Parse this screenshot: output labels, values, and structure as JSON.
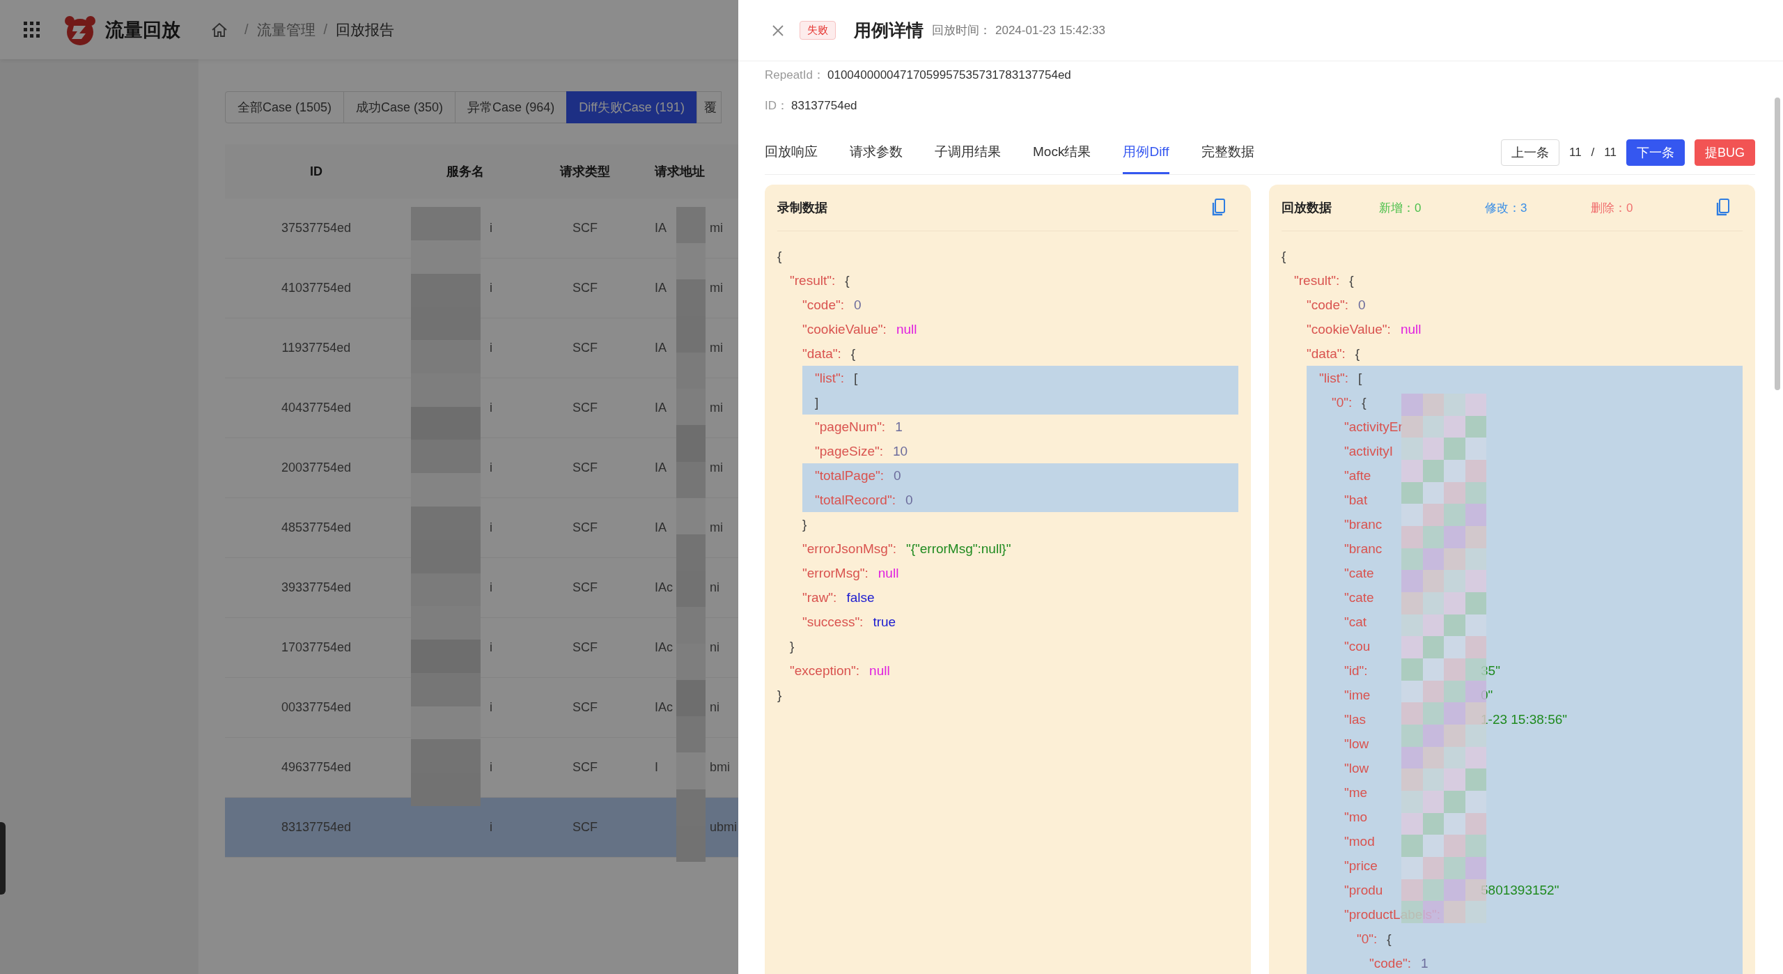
{
  "app": {
    "title": "流量回放",
    "breadcrumb": [
      {
        "separator": "/",
        "label": "流量管理"
      },
      {
        "separator": "/",
        "label": "回放报告"
      }
    ],
    "case_tabs": [
      {
        "label": "全部Case (1505)",
        "selected": false
      },
      {
        "label": "成功Case (350)",
        "selected": false
      },
      {
        "label": "异常Case (964)",
        "selected": false
      },
      {
        "label": "Diff失败Case (191)",
        "selected": true
      },
      {
        "label": "覆",
        "selected": false
      }
    ],
    "table": {
      "columns": [
        "ID",
        "服务名",
        "请求类型",
        "请求地址"
      ],
      "rows": [
        {
          "id": "37537754ed",
          "service": "i",
          "type": "SCF",
          "address": "IA",
          "column_5": "mi",
          "selected": false
        },
        {
          "id": "41037754ed",
          "service": "i",
          "type": "SCF",
          "address": "IA",
          "column_5": "mi",
          "selected": false
        },
        {
          "id": "11937754ed",
          "service": "i",
          "type": "SCF",
          "address": "IA",
          "column_5": "mi",
          "selected": false
        },
        {
          "id": "40437754ed",
          "service": "i",
          "type": "SCF",
          "address": "IA",
          "column_5": "mi",
          "selected": false
        },
        {
          "id": "20037754ed",
          "service": "i",
          "type": "SCF",
          "address": "IA",
          "column_5": "mi",
          "selected": false
        },
        {
          "id": "48537754ed",
          "service": "i",
          "type": "SCF",
          "address": "IA",
          "column_5": "mi",
          "selected": false
        },
        {
          "id": "39337754ed",
          "service": "i",
          "type": "SCF",
          "address": "IAc",
          "column_5": "ni",
          "selected": false
        },
        {
          "id": "17037754ed",
          "service": "i",
          "type": "SCF",
          "address": "IAc",
          "column_5": "ni",
          "selected": false
        },
        {
          "id": "00337754ed",
          "service": "i",
          "type": "SCF",
          "address": "IAc",
          "column_5": "ni",
          "selected": false
        },
        {
          "id": "49637754ed",
          "service": "i",
          "type": "SCF",
          "address": "I",
          "column_5": "bmi",
          "selected": false
        },
        {
          "id": "83137754ed",
          "service": "i",
          "type": "SCF",
          "column_5": "ubmi",
          "selected": true
        }
      ]
    }
  },
  "drawer": {
    "status": "失败",
    "title": "用例详情",
    "time_label": "回放时间：",
    "time": "2024-01-23 15:42:33",
    "repeat_id_label": "RepeatId：",
    "repeat_id": "01004000004717059957535731783137754ed",
    "id_label": "ID：",
    "id": "83137754ed",
    "tabs": [
      {
        "label": "回放响应",
        "selected": false
      },
      {
        "label": "请求参数",
        "selected": false
      },
      {
        "label": "子调用结果",
        "selected": false
      },
      {
        "label": "Mock结果",
        "selected": false
      },
      {
        "label": "用例Diff",
        "selected": true
      },
      {
        "label": "完整数据",
        "selected": false
      }
    ],
    "pager": {
      "prev": "上一条",
      "current": "11",
      "separator": "/",
      "total": "11",
      "next": "下一条"
    },
    "bug_button": "提BUG",
    "panels": [
      {
        "title": "录制数据",
        "code": {
          "kind": "branch",
          "open": "{",
          "close": "}",
          "children": [
            {
              "kind": "branch",
              "key": "\"result\":",
              "open": "{",
              "close": "}",
              "children": [
                {
                  "kind": "pair",
                  "key": "\"code\":",
                  "value": "0",
                  "color": "#6c6c9c"
                },
                {
                  "kind": "pair",
                  "key": "\"cookieValue\":",
                  "value": "null",
                  "color": "#e020e0"
                },
                {
                  "kind": "branch",
                  "key": "\"data\":",
                  "open": "{",
                  "close": "}",
                  "children": [
                    {
                      "kind": "branch",
                      "key": "\"list\":",
                      "open": "[",
                      "close": "]",
                      "highlighted": true
                    },
                    {
                      "kind": "pair",
                      "key": "\"pageNum\":",
                      "value": "1",
                      "color": "#6c6c9c",
                      "highlighted": false
                    },
                    {
                      "kind": "pair",
                      "key": "\"pageSize\":",
                      "value": "10",
                      "color": "#6c6c9c",
                      "highlighted": false
                    },
                    {
                      "kind": "pair",
                      "key": "\"totalPage\":",
                      "value": "0",
                      "color": "#6c6c9c",
                      "highlighted": true
                    },
                    {
                      "kind": "pair",
                      "key": "\"totalRecord\":",
                      "value": "0",
                      "color": "#6c6c9c",
                      "highlighted": true
                    }
                  ]
                },
                {
                  "kind": "pair",
                  "key": "\"errorJsonMsg\":",
                  "value": "\"{\"errorMsg\":null}\"",
                  "color": "#1f8a1f"
                },
                {
                  "kind": "pair",
                  "key": "\"errorMsg\":",
                  "value": "null",
                  "color": "#e020e0"
                },
                {
                  "kind": "pair",
                  "key": "\"raw\":",
                  "value": "false",
                  "color": "#1a1ad0"
                },
                {
                  "kind": "pair",
                  "key": "\"success\":",
                  "value": "true",
                  "color": "#1a1ad0"
                }
              ]
            },
            {
              "kind": "pair",
              "key": "\"exception\":",
              "value": "null",
              "color": "#e020e0"
            }
          ]
        }
      },
      {
        "title": "回放数据",
        "stats": [
          {
            "label": "新增：",
            "value": "0",
            "kind": "added"
          },
          {
            "label": "修改：",
            "value": "3",
            "kind": "modified"
          },
          {
            "label": "删除：",
            "value": "0",
            "kind": "deleted"
          }
        ],
        "code": {
          "kind": "branch",
          "open": "{",
          "children": [
            {
              "kind": "branch",
              "key": "\"result\":",
              "open": "{",
              "children": [
                {
                  "kind": "pair",
                  "key": "\"code\":",
                  "value": "0",
                  "color": "#6c6c9c"
                },
                {
                  "kind": "pair",
                  "key": "\"cookieValue\":",
                  "value": "null",
                  "color": "#e020e0"
                },
                {
                  "kind": "branch",
                  "key": "\"data\":",
                  "open": "{",
                  "children": [
                    {
                      "kind": "branch",
                      "key": "\"list\":",
                      "open": "[",
                      "highlighted": true,
                      "redacted": true,
                      "children": [
                        {
                          "kind": "branch",
                          "key": "\"0\":",
                          "open": "{",
                          "children": [
                            {
                              "kind": "redacted",
                              "key": "\"activityEr"
                            },
                            {
                              "kind": "redacted",
                              "key": "\"activityI"
                            },
                            {
                              "kind": "redacted",
                              "key": "\"afte"
                            },
                            {
                              "kind": "redacted",
                              "key": "\"bat"
                            },
                            {
                              "kind": "redacted",
                              "key": "\"branc"
                            },
                            {
                              "kind": "redacted",
                              "key": "\"branc"
                            },
                            {
                              "kind": "redacted",
                              "key": "\"cate"
                            },
                            {
                              "kind": "redacted",
                              "key": "\"cate"
                            },
                            {
                              "kind": "redacted",
                              "key": "\"cat"
                            },
                            {
                              "kind": "redacted",
                              "key": "\"cou"
                            },
                            {
                              "kind": "redacted",
                              "key": "\"id\":",
                              "value": "35\"",
                              "color": "#1f8a1f"
                            },
                            {
                              "kind": "redacted",
                              "key": "\"ime",
                              "value": "0\"",
                              "color": "#1f8a1f"
                            },
                            {
                              "kind": "redacted",
                              "key": "\"las",
                              "value": "1-23 15:38:56\"",
                              "color": "#1f8a1f"
                            },
                            {
                              "kind": "redacted",
                              "key": "\"low"
                            },
                            {
                              "kind": "redacted",
                              "key": "\"low"
                            },
                            {
                              "kind": "redacted",
                              "key": "\"me"
                            },
                            {
                              "kind": "redacted",
                              "key": "\"mo"
                            },
                            {
                              "kind": "redacted",
                              "key": "\"mod"
                            },
                            {
                              "kind": "redacted",
                              "key": "\"price"
                            },
                            {
                              "kind": "redacted",
                              "key": "\"produ",
                              "value": "5801393152\"",
                              "color": "#1f8a1f"
                            },
                            {
                              "kind": "branch",
                              "key": "\"productLabels\":",
                              "children": [
                                {
                                  "kind": "branch",
                                  "key": "\"0\":",
                                  "open": "{",
                                  "children": [
                                    {
                                      "kind": "pair",
                                      "key": "\"code\":",
                                      "value": "1",
                                      "color": "#6c6c9c"
                                    }
                                  ]
                                }
                              ]
                            }
                          ]
                        }
                      ]
                    }
                  ]
                }
              ]
            }
          ]
        }
      }
    ]
  }
}
